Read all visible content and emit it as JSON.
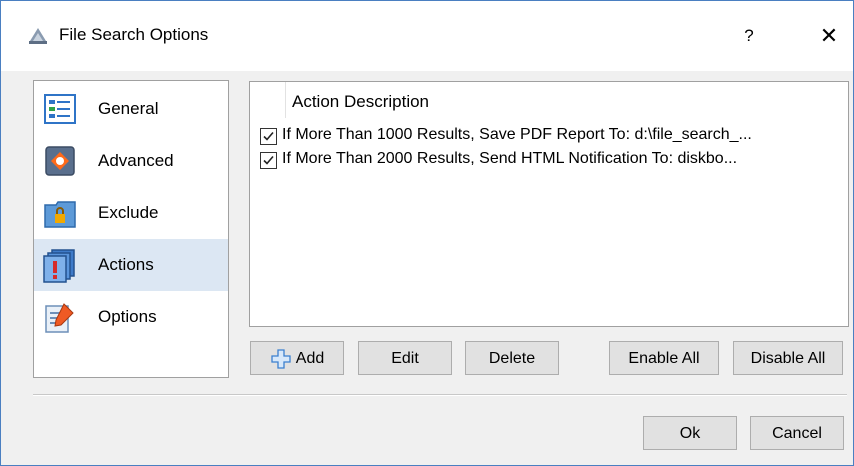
{
  "window": {
    "title": "File Search Options",
    "help_label": "?",
    "close_label": "✕"
  },
  "nav": {
    "items": [
      {
        "label": "General",
        "icon": "general-icon"
      },
      {
        "label": "Advanced",
        "icon": "advanced-icon"
      },
      {
        "label": "Exclude",
        "icon": "exclude-icon"
      },
      {
        "label": "Actions",
        "icon": "actions-icon",
        "selected": true
      },
      {
        "label": "Options",
        "icon": "options-icon"
      }
    ]
  },
  "actions_list": {
    "header": "Action Description",
    "rows": [
      {
        "checked": true,
        "text": "If More Than 1000 Results, Save PDF Report To: d:\\file_search_..."
      },
      {
        "checked": true,
        "text": "If More Than 2000 Results, Send HTML Notification To: diskbo..."
      }
    ]
  },
  "buttons": {
    "add": "Add",
    "edit": "Edit",
    "delete": "Delete",
    "enable_all": "Enable All",
    "disable_all": "Disable All",
    "ok": "Ok",
    "cancel": "Cancel"
  },
  "colors": {
    "selection": "#dce7f3",
    "window_border": "#4a7fc1",
    "dialog_bg": "#f0f0f0"
  }
}
